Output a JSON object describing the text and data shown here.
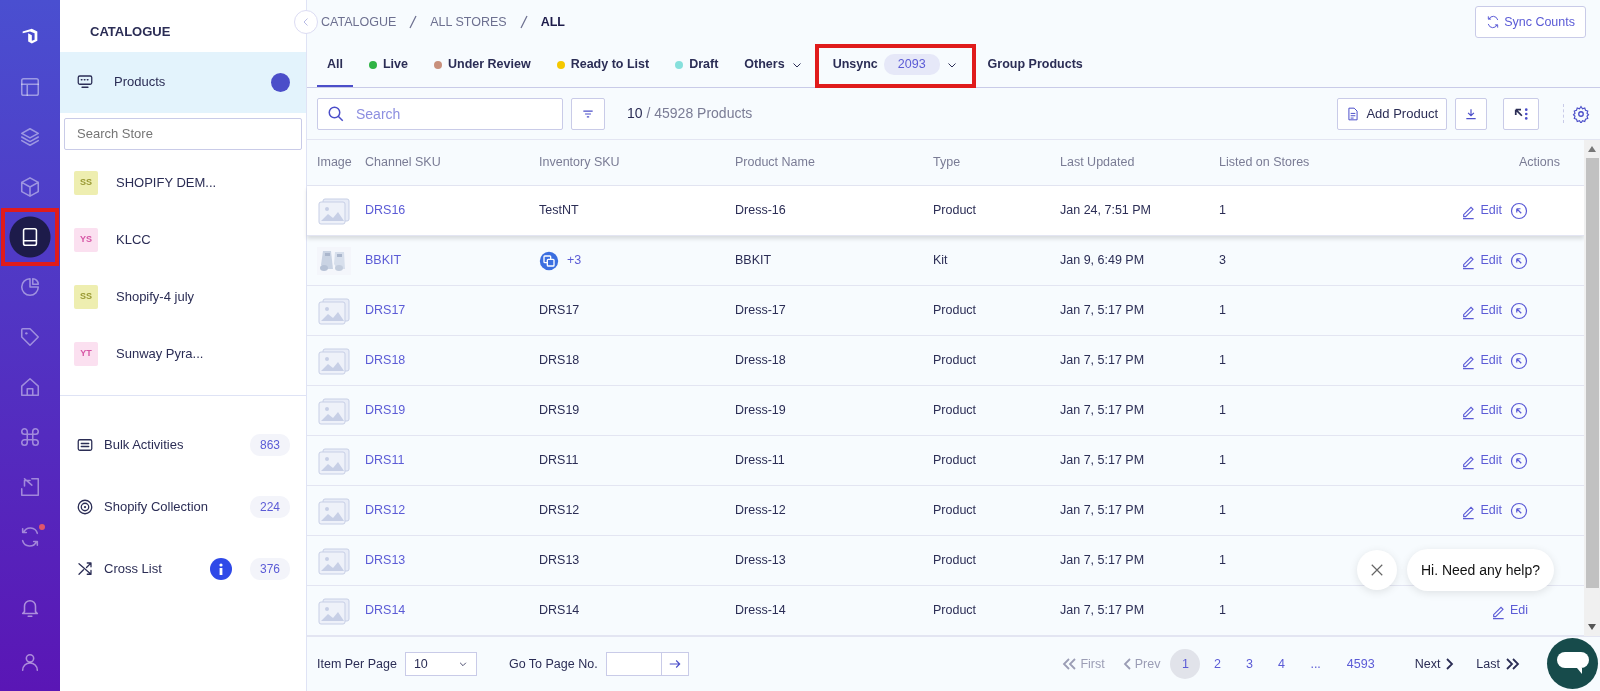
{
  "rail": {
    "items": [
      {
        "kind": "layout",
        "selected": false,
        "alert": false,
        "highlighted": false
      },
      {
        "kind": "layers",
        "selected": false,
        "alert": false,
        "highlighted": false
      },
      {
        "kind": "box",
        "selected": false,
        "alert": false,
        "highlighted": false
      },
      {
        "kind": "book",
        "selected": true,
        "alert": false,
        "highlighted": true
      },
      {
        "kind": "pie",
        "selected": false,
        "alert": false,
        "highlighted": false
      },
      {
        "kind": "tag",
        "selected": false,
        "alert": false,
        "highlighted": false
      },
      {
        "kind": "home",
        "selected": false,
        "alert": false,
        "highlighted": false
      },
      {
        "kind": "command",
        "selected": false,
        "alert": false,
        "highlighted": false
      },
      {
        "kind": "import",
        "selected": false,
        "alert": false,
        "highlighted": false
      },
      {
        "kind": "sync",
        "selected": false,
        "alert": true,
        "highlighted": false
      }
    ],
    "bottom": [
      {
        "kind": "bell"
      },
      {
        "kind": "user"
      }
    ]
  },
  "sidebar": {
    "title": "CATALOGUE",
    "products": {
      "label": "Products",
      "selected": true
    },
    "search": {
      "placeholder": "Search Store"
    },
    "stores": [
      {
        "initials": "SS",
        "name": "SHOPIFY DEM...",
        "color": "#eeeeb0"
      },
      {
        "initials": "YS",
        "name": "KLCC",
        "color": "#fbe0f0"
      },
      {
        "initials": "SS",
        "name": "Shopify-4 july",
        "color": "#eeeeb0"
      },
      {
        "initials": "YT",
        "name": "Sunway Pyra...",
        "color": "#fbe0f0"
      }
    ],
    "links": [
      {
        "kind": "bulk",
        "label": "Bulk Activities",
        "count": "863",
        "info": false
      },
      {
        "kind": "collection",
        "label": "Shopify Collection",
        "count": "224",
        "info": false
      },
      {
        "kind": "crosslist",
        "label": "Cross List",
        "count": "376",
        "info": true
      }
    ]
  },
  "breadcrumb": [
    "CATALOGUE",
    "ALL STORES",
    "ALL"
  ],
  "sync_button": "Sync Counts",
  "tabs": [
    {
      "label": "All",
      "selected": true,
      "dropdown": false,
      "highlighted": false
    },
    {
      "label": "Live",
      "color": "#2fb344",
      "selected": false,
      "dropdown": false,
      "highlighted": false
    },
    {
      "label": "Under Review",
      "color": "#c8907c",
      "selected": false,
      "dropdown": false,
      "highlighted": false
    },
    {
      "label": "Ready to List",
      "color": "#f5c800",
      "selected": false,
      "dropdown": false,
      "highlighted": false
    },
    {
      "label": "Draft",
      "color": "#86e0dc",
      "selected": false,
      "dropdown": false,
      "highlighted": false
    },
    {
      "label": "Others",
      "selected": false,
      "dropdown": true,
      "highlighted": false
    },
    {
      "label": "Unsync",
      "count": "2093",
      "selected": false,
      "dropdown": true,
      "highlighted": true
    },
    {
      "label": "Group Products",
      "selected": false,
      "dropdown": false,
      "highlighted": false
    }
  ],
  "toolbar": {
    "search_placeholder": "Search",
    "shown": "10",
    "total": "/ 45928 Products",
    "add_button": "Add Product"
  },
  "table": {
    "columns": [
      "Image",
      "Channel SKU",
      "Inventory SKU",
      "Product Name",
      "Type",
      "Last Updated",
      "Listed on Stores",
      "Actions"
    ],
    "rows": [
      {
        "kind": "product",
        "sku": "DRS16",
        "inventory": "TestNT",
        "name": "Dress-16",
        "type": "Product",
        "updated": "Jan 24, 7:51 PM",
        "stores": "1",
        "edit": "Edit",
        "hovered": true
      },
      {
        "kind": "kit",
        "sku": "BBKIT",
        "inventory": "+3",
        "name": "BBKIT",
        "type": "Kit",
        "updated": "Jan 9, 6:49 PM",
        "stores": "3",
        "edit": "Edit",
        "hovered": false
      },
      {
        "kind": "product",
        "sku": "DRS17",
        "inventory": "DRS17",
        "name": "Dress-17",
        "type": "Product",
        "updated": "Jan 7, 5:17 PM",
        "stores": "1",
        "edit": "Edit",
        "hovered": false
      },
      {
        "kind": "product",
        "sku": "DRS18",
        "inventory": "DRS18",
        "name": "Dress-18",
        "type": "Product",
        "updated": "Jan 7, 5:17 PM",
        "stores": "1",
        "edit": "Edit",
        "hovered": false
      },
      {
        "kind": "product",
        "sku": "DRS19",
        "inventory": "DRS19",
        "name": "Dress-19",
        "type": "Product",
        "updated": "Jan 7, 5:17 PM",
        "stores": "1",
        "edit": "Edit",
        "hovered": false
      },
      {
        "kind": "product",
        "sku": "DRS11",
        "inventory": "DRS11",
        "name": "Dress-11",
        "type": "Product",
        "updated": "Jan 7, 5:17 PM",
        "stores": "1",
        "edit": "Edit",
        "hovered": false
      },
      {
        "kind": "product",
        "sku": "DRS12",
        "inventory": "DRS12",
        "name": "Dress-12",
        "type": "Product",
        "updated": "Jan 7, 5:17 PM",
        "stores": "1",
        "edit": "Edit",
        "hovered": false
      },
      {
        "kind": "product",
        "sku": "DRS13",
        "inventory": "DRS13",
        "name": "Dress-13",
        "type": "Product",
        "updated": "Jan 7, 5:17 PM",
        "stores": "1",
        "hovered": false
      },
      {
        "kind": "product",
        "sku": "DRS14",
        "inventory": "DRS14",
        "name": "Dress-14",
        "type": "Product",
        "updated": "Jan 7, 5:17 PM",
        "stores": "1",
        "edit": "Edi",
        "hovered": false
      }
    ]
  },
  "footer": {
    "per_page_label": "Item Per Page",
    "per_page": "10",
    "goto_label": "Go To Page No.",
    "first": "First",
    "prev": "Prev",
    "pages": [
      {
        "label": "1",
        "selected": true
      },
      {
        "label": "2",
        "selected": false
      },
      {
        "label": "3",
        "selected": false
      },
      {
        "label": "4",
        "selected": false
      },
      {
        "label": "...",
        "selected": false
      },
      {
        "label": "4593",
        "selected": false
      }
    ],
    "next": "Next",
    "last": "Last"
  },
  "chat": {
    "message": "Hi. Need any help?"
  }
}
